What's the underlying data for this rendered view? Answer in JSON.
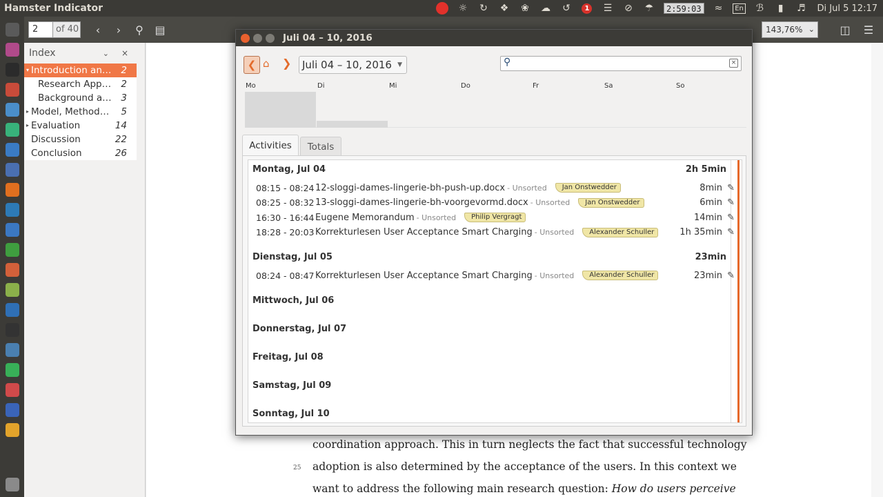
{
  "topbar": {
    "app_title": "Hamster Indicator",
    "timer": "2:59:03",
    "notification_count": "1",
    "language": "En",
    "datetime": "Di Jul 5 12:17",
    "icons": [
      "record-icon",
      "lightbulb-icon",
      "sync-icon",
      "dropbox-icon",
      "network-icon",
      "cloud-icon",
      "refresh-icon",
      "notification-badge",
      "stripes-icon",
      "blocked-icon",
      "weather-icon",
      "timer-display",
      "wifi-icon",
      "keyboard-layout",
      "bluetooth-icon",
      "battery-icon",
      "volume-icon"
    ]
  },
  "launcher": {
    "items": [
      {
        "name": "dash-icon",
        "color": "#5a5a5a"
      },
      {
        "name": "notes-icon",
        "color": "#b04a8a"
      },
      {
        "name": "terminal-icon",
        "color": "#2b2b2b"
      },
      {
        "name": "archive-icon",
        "color": "#c84b3a"
      },
      {
        "name": "chromium-icon",
        "color": "#4a8ec9"
      },
      {
        "name": "chat-icon",
        "color": "#38b27a"
      },
      {
        "name": "disk-icon",
        "color": "#3a7bc4"
      },
      {
        "name": "calendar-icon",
        "color": "#4a6fb0"
      },
      {
        "name": "firefox-icon",
        "color": "#e06f1f"
      },
      {
        "name": "wordpress-icon",
        "color": "#2d7ab6"
      },
      {
        "name": "writer-icon",
        "color": "#3b78c2"
      },
      {
        "name": "calc-icon",
        "color": "#3f9e3f"
      },
      {
        "name": "impress-icon",
        "color": "#d2603a"
      },
      {
        "name": "screenshot-icon",
        "color": "#8bb04a"
      },
      {
        "name": "trello-icon",
        "color": "#2f6fb5"
      },
      {
        "name": "camera-icon",
        "color": "#333333"
      },
      {
        "name": "virtualbox-icon",
        "color": "#4a7fb0"
      },
      {
        "name": "whatsapp-icon",
        "color": "#38b058"
      },
      {
        "name": "app-red-icon",
        "color": "#d04a4a"
      },
      {
        "name": "clock-icon",
        "color": "#3a64b8"
      },
      {
        "name": "hamster-icon",
        "color": "#e2a32b"
      }
    ],
    "trash": {
      "name": "trash-icon",
      "color": "#8a8a8a"
    }
  },
  "viewer": {
    "page_value": "2",
    "page_of": "of 40",
    "zoom": "143,76%"
  },
  "index": {
    "title": "Index",
    "items": [
      {
        "label": "Introduction and ...",
        "page": "2",
        "arrow": "▾",
        "indent": 0,
        "selected": true
      },
      {
        "label": "Research Appro...",
        "page": "2",
        "arrow": "",
        "indent": 1,
        "selected": false
      },
      {
        "label": "Background and...",
        "page": "3",
        "arrow": "",
        "indent": 1,
        "selected": false
      },
      {
        "label": "Model, Methodol...",
        "page": "5",
        "arrow": "▸",
        "indent": 0,
        "selected": false
      },
      {
        "label": "Evaluation",
        "page": "14",
        "arrow": "▸",
        "indent": 0,
        "selected": false
      },
      {
        "label": "Discussion",
        "page": "22",
        "arrow": "",
        "indent": 0,
        "selected": false
      },
      {
        "label": "Conclusion",
        "page": "26",
        "arrow": "",
        "indent": 0,
        "selected": false
      }
    ]
  },
  "document": {
    "lines": [
      {
        "text": "coordination approach. This in turn neglects the fact that successful technology",
        "num": ""
      },
      {
        "text": "adoption is also determined by the acceptance of the users. In this context we",
        "num": "25"
      },
      {
        "text": "want to address the following main research question: How do users perceive",
        "num": ""
      }
    ]
  },
  "hamster": {
    "window_title": "Juli 04 – 10, 2016",
    "range_label": "Juli 04 – 10, 2016",
    "search_placeholder": "",
    "weekdays": [
      "Mo",
      "Di",
      "Mi",
      "Do",
      "Fr",
      "Sa",
      "So"
    ],
    "week_chart": {
      "days": [
        "Mo",
        "Di",
        "Mi",
        "Do",
        "Fr",
        "Sa",
        "So"
      ],
      "minutes": [
        125,
        23,
        0,
        0,
        0,
        0,
        0
      ]
    },
    "tabs": {
      "activities": "Activities",
      "totals": "Totals"
    },
    "days": [
      {
        "header": "Montag, Jul 04",
        "total": "2h 5min",
        "facts": [
          {
            "time": "08:15 - 08:24",
            "name": "12-sloggi-dames-lingerie-bh-push-up.docx",
            "category": "- Unsorted",
            "tag": "Jan Onstwedder",
            "duration": "8min"
          },
          {
            "time": "08:25 - 08:32",
            "name": "13-sloggi-dames-lingerie-bh-voorgevormd.docx",
            "category": "- Unsorted",
            "tag": "Jan Onstwedder",
            "duration": "6min"
          },
          {
            "time": "16:30 - 16:44",
            "name": "Eugene Memorandum",
            "category": "- Unsorted",
            "tag": "Philip Vergragt",
            "duration": "14min"
          },
          {
            "time": "18:28 - 20:03",
            "name": "Korrekturlesen User Acceptance Smart Charging",
            "category": "- Unsorted",
            "tag": "Alexander Schuller",
            "duration": "1h 35min"
          }
        ]
      },
      {
        "header": "Dienstag, Jul 05",
        "total": "23min",
        "facts": [
          {
            "time": "08:24 - 08:47",
            "name": "Korrekturlesen User Acceptance Smart Charging",
            "category": "- Unsorted",
            "tag": "Alexander Schuller",
            "duration": "23min"
          }
        ]
      },
      {
        "header": "Mittwoch, Jul 06",
        "total": "",
        "facts": []
      },
      {
        "header": "Donnerstag, Jul 07",
        "total": "",
        "facts": []
      },
      {
        "header": "Freitag, Jul 08",
        "total": "",
        "facts": []
      },
      {
        "header": "Samstag, Jul 09",
        "total": "",
        "facts": []
      },
      {
        "header": "Sonntag, Jul 10",
        "total": "",
        "facts": []
      }
    ]
  }
}
